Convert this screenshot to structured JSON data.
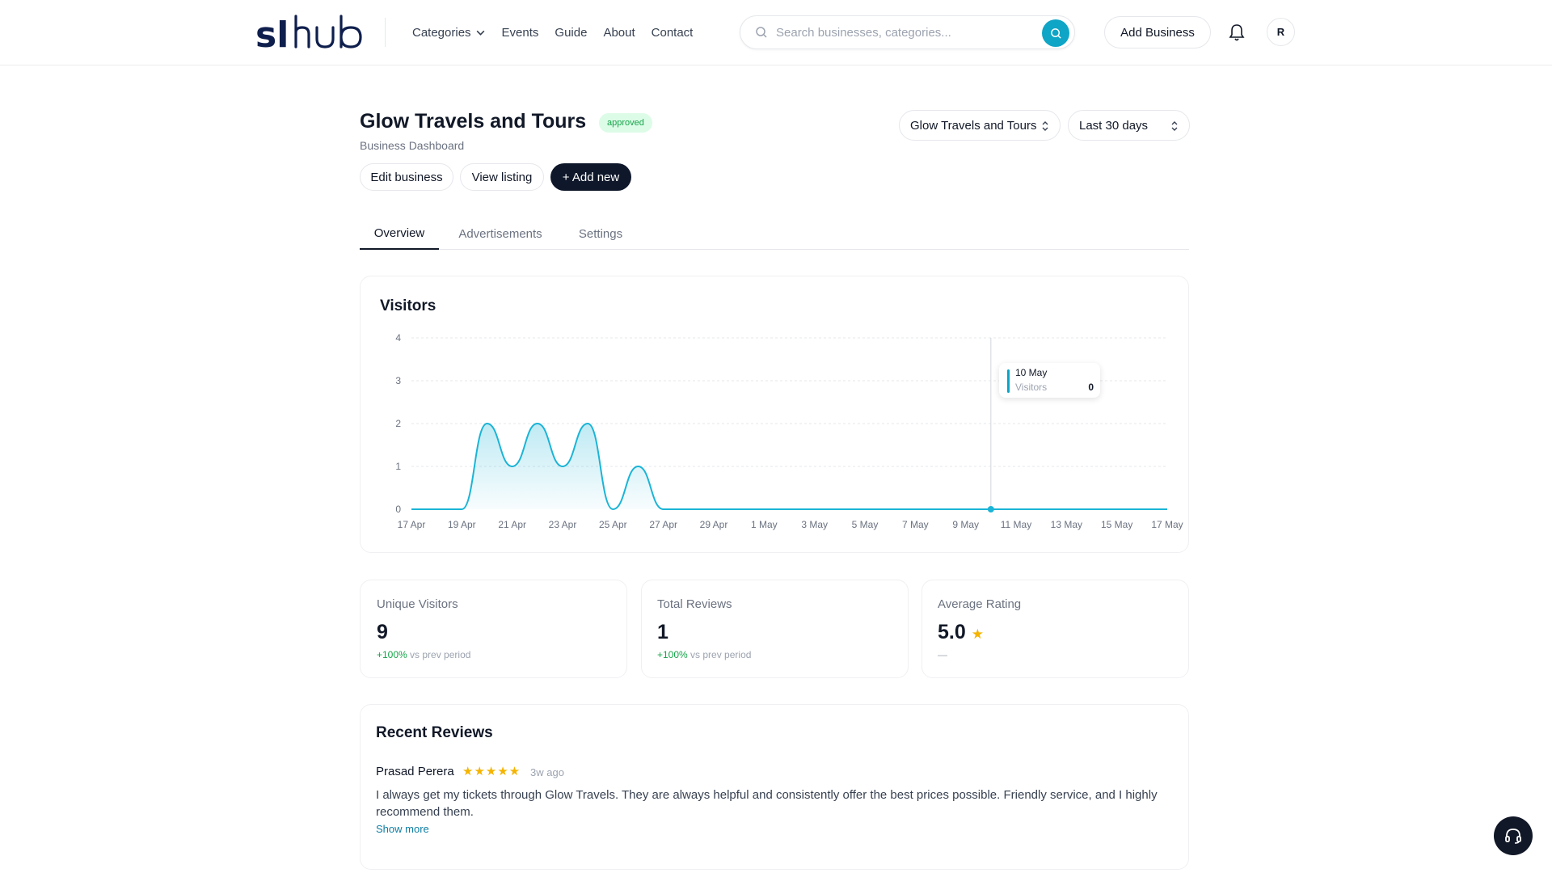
{
  "header": {
    "logo": "slhub",
    "nav": [
      "Categories",
      "Events",
      "Guide",
      "About",
      "Contact"
    ],
    "search_placeholder": "Search businesses, categories...",
    "add_business": "Add Business",
    "avatar_initial": "R"
  },
  "business": {
    "title": "Glow Travels and Tours",
    "status": "approved",
    "subtitle": "Business Dashboard",
    "actions": {
      "edit": "Edit business",
      "view": "View listing",
      "add_new": "+ Add new"
    },
    "business_select": "Glow Travels and Tours",
    "range_select": "Last 30 days"
  },
  "tabs": [
    "Overview",
    "Advertisements",
    "Settings"
  ],
  "visitors": {
    "title": "Visitors",
    "tooltip": {
      "date": "10 May",
      "label": "Visitors",
      "value": "0"
    }
  },
  "chart_data": {
    "type": "area",
    "title": "Visitors",
    "x": [
      "17 Apr",
      "18 Apr",
      "19 Apr",
      "20 Apr",
      "21 Apr",
      "22 Apr",
      "23 Apr",
      "24 Apr",
      "25 Apr",
      "26 Apr",
      "27 Apr",
      "28 Apr",
      "29 Apr",
      "30 Apr",
      "1 May",
      "2 May",
      "3 May",
      "4 May",
      "5 May",
      "6 May",
      "7 May",
      "8 May",
      "9 May",
      "10 May",
      "11 May",
      "12 May",
      "13 May",
      "14 May",
      "15 May",
      "16 May",
      "17 May"
    ],
    "x_tick_labels": [
      "17 Apr",
      "19 Apr",
      "21 Apr",
      "23 Apr",
      "25 Apr",
      "27 Apr",
      "29 Apr",
      "1 May",
      "3 May",
      "5 May",
      "7 May",
      "9 May",
      "11 May",
      "13 May",
      "15 May",
      "17 May"
    ],
    "series": [
      {
        "values": [
          0,
          0,
          0,
          2,
          1,
          2,
          1,
          2,
          0,
          1,
          0,
          0,
          0,
          0,
          0,
          0,
          0,
          0,
          0,
          0,
          0,
          0,
          0,
          0,
          0,
          0,
          0,
          0,
          0,
          0,
          0
        ]
      }
    ],
    "ylim": [
      0,
      4
    ],
    "yticks": [
      0,
      1,
      2,
      3,
      4
    ],
    "grid": true,
    "color": "#1bb4d6"
  },
  "stats": [
    {
      "label": "Unique Visitors",
      "value": "9",
      "change": "+100%",
      "suffix": "vs prev period"
    },
    {
      "label": "Total Reviews",
      "value": "1",
      "change": "+100%",
      "suffix": "vs prev period"
    },
    {
      "label": "Average Rating",
      "value": "5.0",
      "star": "★",
      "change": "—"
    }
  ],
  "recent_reviews": {
    "title": "Recent Reviews",
    "items": [
      {
        "name": "Prasad Perera",
        "stars": "★★★★★",
        "time": "3w ago",
        "text": "I always get my tickets through Glow Travels. They are always helpful and consistently offer the best prices possible. Friendly service, and I highly recommend them.",
        "show_more": "Show more"
      }
    ]
  }
}
